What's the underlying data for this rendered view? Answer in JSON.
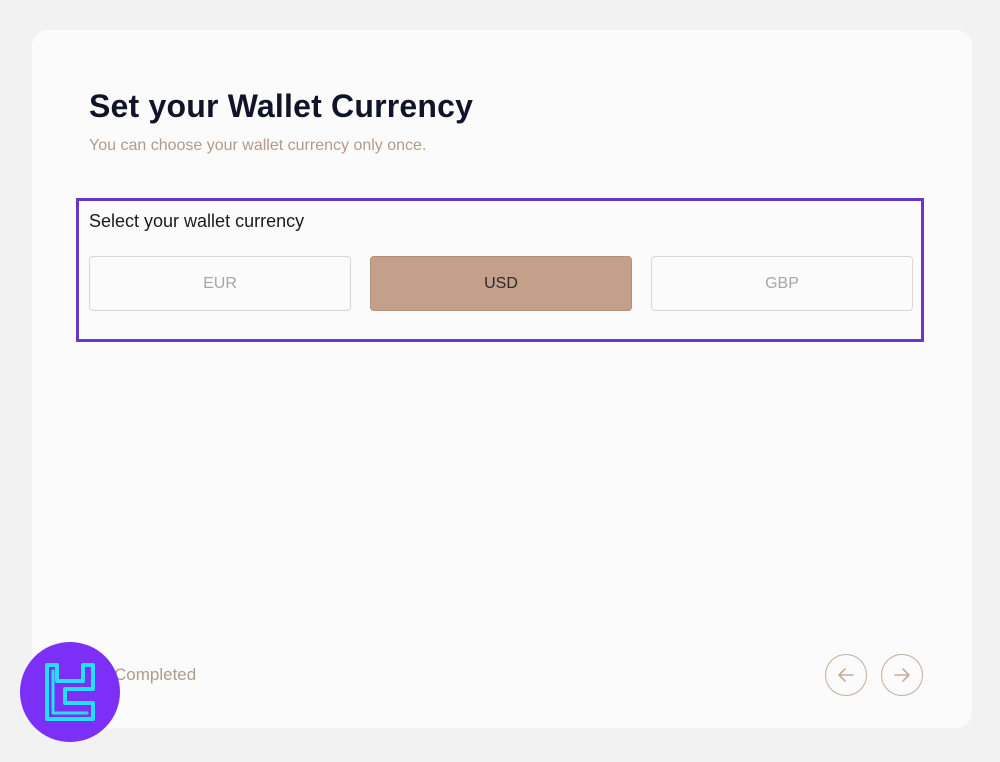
{
  "header": {
    "title": "Set your Wallet Currency",
    "subtitle": "You can choose your wallet currency only once."
  },
  "currency_select": {
    "label": "Select your wallet currency",
    "options": [
      "EUR",
      "USD",
      "GBP"
    ],
    "selected": "USD"
  },
  "footer": {
    "status": "Completed",
    "prev_icon": "arrow-left-icon",
    "next_icon": "arrow-right-icon"
  },
  "colors": {
    "accent": "#c4a08b",
    "highlight_border": "#6a35c8",
    "logo_bg": "#7b2ff7",
    "logo_fg": "#25e0f0"
  }
}
